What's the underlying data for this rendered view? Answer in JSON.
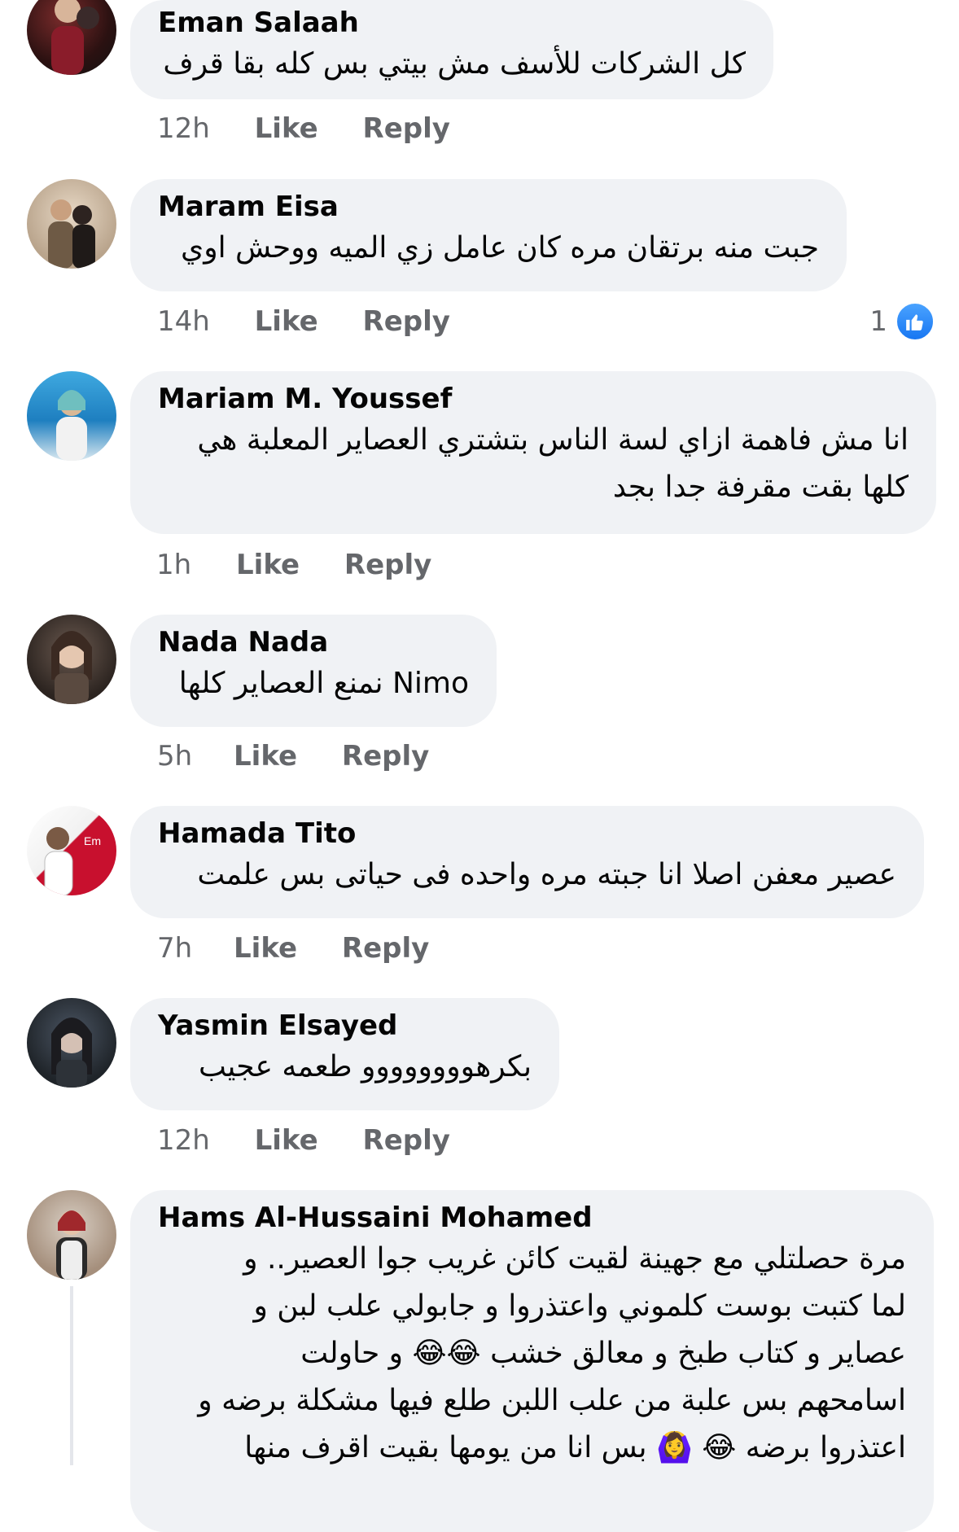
{
  "comments": [
    {
      "name": "Eman Salaah",
      "lines": [
        "كل الشركات للأسف مش بيتي بس كله بقا قرف"
      ],
      "time": "12h",
      "like": "Like",
      "reply": "Reply",
      "avatar_icon": "user-avatar-icon"
    },
    {
      "name": "Maram Eisa",
      "lines": [
        "جبت منه برتقان مره كان عامل زي الميه ووحش اوي"
      ],
      "time": "14h",
      "like": "Like",
      "reply": "Reply",
      "reaction_count": "1",
      "avatar_icon": "user-avatar-icon"
    },
    {
      "name": "Mariam M. Youssef",
      "lines": [
        "انا مش فاهمة ازاي لسة الناس بتشتري العصاير المعلبة هي",
        "كلها بقت مقرفة جدا بجد"
      ],
      "time": "1h",
      "like": "Like",
      "reply": "Reply",
      "avatar_icon": "user-avatar-icon"
    },
    {
      "name": "Nada Nada",
      "lines": [
        "Nimo نمنع العصاير كلها"
      ],
      "time": "5h",
      "like": "Like",
      "reply": "Reply",
      "avatar_icon": "user-avatar-icon"
    },
    {
      "name": "Hamada Tito",
      "lines": [
        "عصير معفن اصلا انا جبته مره واحده فى حياتى بس علمت"
      ],
      "time": "7h",
      "like": "Like",
      "reply": "Reply",
      "avatar_icon": "user-avatar-icon"
    },
    {
      "name": "Yasmin Elsayed",
      "lines": [
        "بكرهوووووووو طعمه عجيب"
      ],
      "time": "12h",
      "like": "Like",
      "reply": "Reply",
      "avatar_icon": "user-avatar-icon"
    },
    {
      "name": "Hams Al-Hussaini Mohamed",
      "lines": [
        "مرة حصلتلي مع جهينة لقيت كائن غريب جوا العصير.. و",
        "لما كتبت بوست كلموني واعتذروا و جابولي علب لبن و",
        "عصاير و كتاب طبخ و معالق خشب 😂😂 و حاولت",
        "اسامحهم بس علبة من علب اللبن طلع فيها مشكلة برضه و",
        "اعتذروا برضه 😂 🙆‍♀️ بس انا من يومها بقيت اقرف منها"
      ],
      "avatar_icon": "user-avatar-icon"
    }
  ],
  "colors": {
    "bubble": "#f0f2f5",
    "meta_text": "#65676b",
    "like_badge": "#1877f2"
  },
  "icons": {
    "like_reaction": "thumbs-up-icon"
  }
}
